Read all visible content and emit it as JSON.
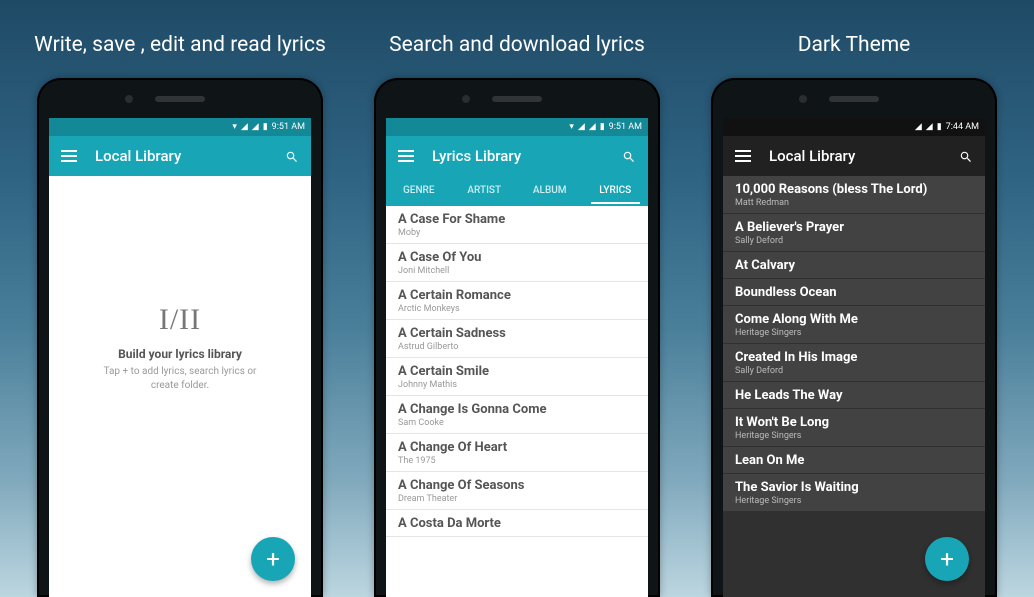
{
  "panels": [
    {
      "caption": "Write, save , edit and read lyrics"
    },
    {
      "caption": "Search and download lyrics"
    },
    {
      "caption": "Dark Theme"
    }
  ],
  "screen1": {
    "statusTime": "9:51 AM",
    "title": "Local Library",
    "emptyLogo": "I/II",
    "emptyHeading": "Build your lyrics library",
    "emptySub": "Tap + to add lyrics, search lyrics or create folder.",
    "fab": "+"
  },
  "screen2": {
    "statusTime": "9:51 AM",
    "title": "Lyrics Library",
    "tabs": [
      "GENRE",
      "ARTIST",
      "ALBUM",
      "LYRICS"
    ],
    "activeTab": 3,
    "items": [
      {
        "t": "A Case For Shame",
        "a": "Moby"
      },
      {
        "t": "A Case Of You",
        "a": "Joni Mitchell"
      },
      {
        "t": "A Certain Romance",
        "a": "Arctic Monkeys"
      },
      {
        "t": "A Certain Sadness",
        "a": "Astrud Gilberto"
      },
      {
        "t": "A Certain Smile",
        "a": "Johnny Mathis"
      },
      {
        "t": "A Change Is Gonna Come",
        "a": "Sam Cooke"
      },
      {
        "t": "A Change Of Heart",
        "a": "The 1975"
      },
      {
        "t": "A Change Of Seasons",
        "a": "Dream Theater"
      },
      {
        "t": "A Costa Da Morte",
        "a": ""
      }
    ]
  },
  "screen3": {
    "statusTime": "7:44 AM",
    "title": "Local Library",
    "fab": "+",
    "items": [
      {
        "t": "10,000 Reasons (bless The Lord)",
        "a": "Matt Redman"
      },
      {
        "t": "A Believer's Prayer",
        "a": "Sally Deford"
      },
      {
        "t": "At Calvary",
        "a": ""
      },
      {
        "t": "Boundless Ocean",
        "a": ""
      },
      {
        "t": "Come Along With Me",
        "a": "Heritage Singers"
      },
      {
        "t": "Created In His Image",
        "a": "Sally Deford"
      },
      {
        "t": "He Leads The Way",
        "a": ""
      },
      {
        "t": "It Won't Be Long",
        "a": "Heritage Singers"
      },
      {
        "t": "Lean On Me",
        "a": ""
      },
      {
        "t": "The Savior Is Waiting",
        "a": "Heritage Singers"
      }
    ]
  }
}
